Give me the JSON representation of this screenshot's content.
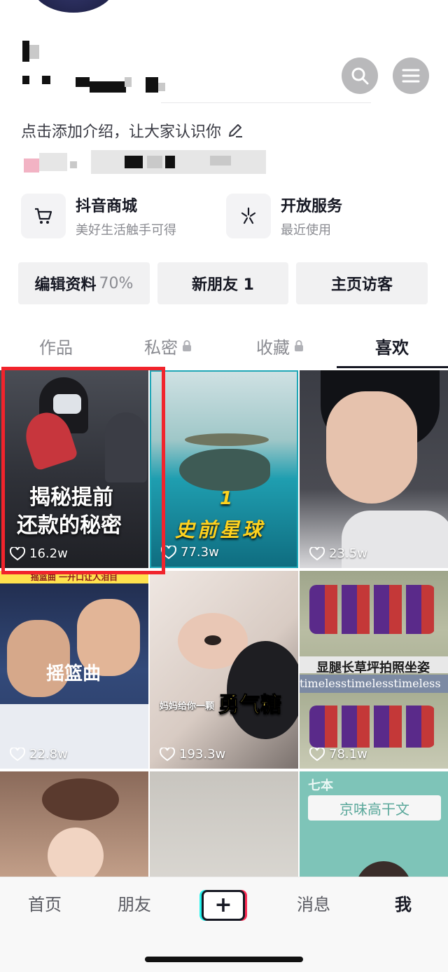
{
  "profile": {
    "bio_placeholder": "点击添加介绍，让大家认识你"
  },
  "services": [
    {
      "title": "抖音商城",
      "subtitle": "美好生活触手可得",
      "icon": "cart-icon"
    },
    {
      "title": "开放服务",
      "subtitle": "最近使用",
      "icon": "sparkle-icon"
    }
  ],
  "actions": {
    "edit_profile": "编辑资料",
    "edit_profile_percent": "70%",
    "new_friends": "新朋友 1",
    "visitors": "主页访客"
  },
  "tabs": [
    {
      "label": "作品",
      "locked": false,
      "active": false
    },
    {
      "label": "私密",
      "locked": true,
      "active": false
    },
    {
      "label": "收藏",
      "locked": true,
      "active": false
    },
    {
      "label": "喜欢",
      "locked": false,
      "active": true
    }
  ],
  "videos": [
    {
      "likes": "16.2w",
      "caption_1": "揭秘提前",
      "caption_2": "还款的秘密"
    },
    {
      "likes": "77.3w",
      "caption_num": "1",
      "caption_1": "史前星球"
    },
    {
      "likes": "23.5w"
    },
    {
      "likes": "22.8w",
      "caption_top": "摇篮曲 一开口让人泪目",
      "caption_1": "摇篮曲"
    },
    {
      "likes": "193.3w",
      "caption_small": "妈妈给你一颗",
      "caption_1": "勇气糖"
    },
    {
      "likes": "78.1w",
      "caption_1": "显腿长草坪拍照坐姿",
      "caption_2": "timelesstimelesstimeless"
    },
    {},
    {},
    {
      "caption_small": "七本",
      "caption_1": "京味高干文"
    }
  ],
  "bottom_nav": {
    "home": "首页",
    "friends": "朋友",
    "plus": "+",
    "messages": "消息",
    "me": "我"
  },
  "colors": {
    "highlight_frame": "#f1242c",
    "accent_cyan": "#25f4ee",
    "accent_pink": "#fe2c55"
  }
}
